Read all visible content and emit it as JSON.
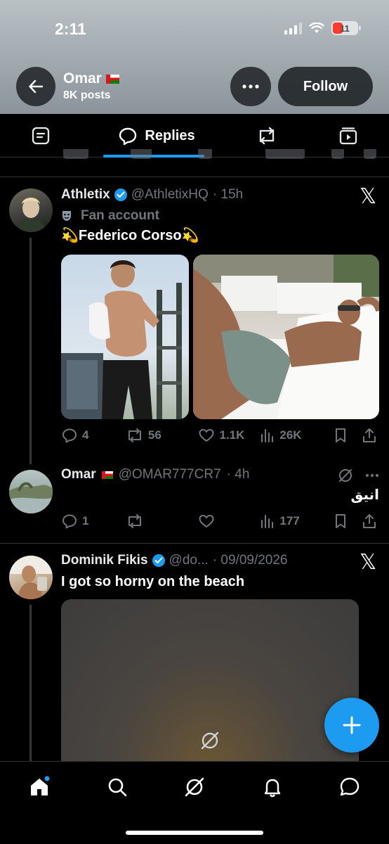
{
  "status_bar": {
    "time": "2:11",
    "battery": "11"
  },
  "profile": {
    "name": "Omar",
    "posts": "8K posts"
  },
  "header": {
    "follow_label": "Follow"
  },
  "tabs": {
    "active_label": "Replies"
  },
  "tweets": [
    {
      "name": "Athletix",
      "handle": "@AthletixHQ",
      "time": "· 15h",
      "fan_label": "Fan account",
      "text": "💫Federico Corso💫",
      "stats": {
        "replies": "4",
        "retweets": "56",
        "likes": "1.1K",
        "views": "26K"
      }
    },
    {
      "name": "Omar",
      "handle": "@OMAR777CR7",
      "time": "· 4h",
      "text": "انيق",
      "stats": {
        "replies": "1",
        "retweets": "",
        "likes": "",
        "views": "177"
      }
    },
    {
      "name": "Dominik Fikis",
      "handle": "@do...",
      "time": "· 09/09/2026",
      "text": "I got so horny on the beach"
    }
  ],
  "colors": {
    "accent": "#1d9bf0",
    "muted": "#71767b",
    "divider": "#2f3336"
  },
  "icons": [
    "back-arrow-icon",
    "more-icon",
    "posts-tab-icon",
    "replies-tab-icon",
    "repost-tab-icon",
    "media-tab-icon",
    "reply-icon",
    "repost-icon",
    "like-icon",
    "views-icon",
    "bookmark-icon",
    "share-icon",
    "x-logo-icon",
    "verified-icon",
    "grok-icon",
    "home-icon",
    "search-icon",
    "notifications-icon",
    "messages-icon",
    "compose-icon"
  ]
}
